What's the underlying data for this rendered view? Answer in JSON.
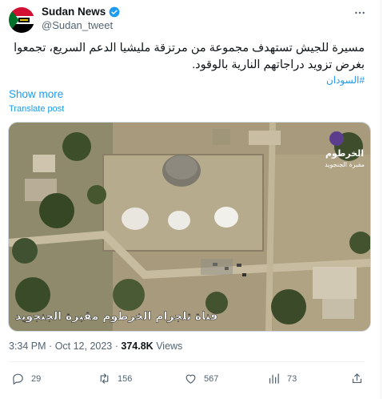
{
  "author": {
    "name": "Sudan News",
    "handle": "@Sudan_tweet",
    "verified_color": "#1d9bf0"
  },
  "tweet": {
    "text": "مسيرة للجيش تستهدف مجموعة من مرتزقة مليشيا الدعم السريع، تجمعوا بغرض تزويد دراجاتهم النارية بالوقود.",
    "hashtag": "#السودان",
    "show_more": "Show more",
    "translate": "Translate post"
  },
  "media": {
    "logo_text_line1": "الخرطوم",
    "logo_text_line2": "مقبرة الجنجويد",
    "caption": "قناة تلجرام الخرطوم مقبرة الجنجويد"
  },
  "meta": {
    "time": "3:34 PM",
    "date": "Oct 12, 2023",
    "views_count": "374.8K",
    "views_label": "Views"
  },
  "actions": {
    "reply_count": "29",
    "retweet_count": "156",
    "like_count": "567",
    "bookmark_count": "73"
  }
}
